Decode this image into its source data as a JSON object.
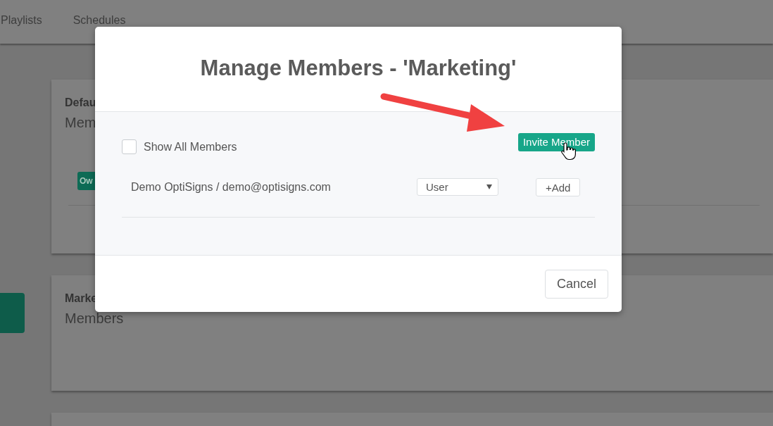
{
  "nav": {
    "items": [
      {
        "label": "Playlists"
      },
      {
        "label": "Schedules"
      }
    ]
  },
  "groups": [
    {
      "title": "Defau",
      "subtitle": "Mem",
      "badge": "Ow",
      "side_block": false
    },
    {
      "title": "Marke",
      "subtitle": "Members",
      "side_block": true
    }
  ],
  "modal": {
    "title": "Manage Members - 'Marketing'",
    "show_all": {
      "label": "Show All Members",
      "checked": false
    },
    "invite_button": "Invite Member",
    "members": [
      {
        "name": "Demo OptiSigns / demo@optisigns.com",
        "role": "User",
        "action": "+Add"
      }
    ],
    "cancel_button": "Cancel"
  }
}
